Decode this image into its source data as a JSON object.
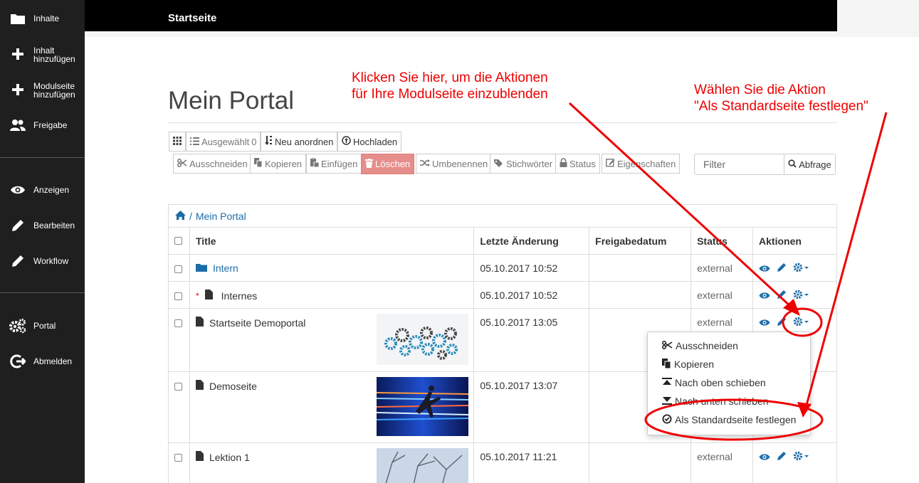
{
  "sidebar": {
    "items": [
      {
        "label": "Inhalte",
        "icon": "folder-icon"
      },
      {
        "label": "Inhalt",
        "label2": "hinzufügen",
        "icon": "plus-icon"
      },
      {
        "label": "Modulseite",
        "label2": "hinzufügen",
        "icon": "plus-icon"
      },
      {
        "label": "Freigabe",
        "icon": "users-icon"
      },
      {
        "label": "Anzeigen",
        "icon": "eye-icon"
      },
      {
        "label": "Bearbeiten",
        "icon": "pencil-icon"
      },
      {
        "label": "Workflow",
        "icon": "pencil-icon"
      },
      {
        "label": "Portal",
        "icon": "gears-icon"
      },
      {
        "label": "Abmelden",
        "icon": "logout-icon"
      }
    ]
  },
  "header": {
    "title": "Startseite"
  },
  "page": {
    "title": "Mein Portal"
  },
  "toolbar": {
    "selected_label": "Ausgewählt",
    "selected_count": "0",
    "reorder": "Neu anordnen",
    "upload": "Hochladen",
    "cut": "Ausschneiden",
    "copy": "Kopieren",
    "paste": "Einfügen",
    "delete": "Löschen",
    "rename": "Umbenennen",
    "tags": "Stichwörter",
    "status": "Status",
    "properties": "Eigenschaften"
  },
  "filter": {
    "placeholder": "Filter",
    "button": "Abfrage"
  },
  "breadcrumb": {
    "separator": "/",
    "current": "Mein Portal"
  },
  "table": {
    "headers": {
      "title": "Title",
      "modified": "Letzte Änderung",
      "published": "Freigabedatum",
      "status": "Status",
      "actions": "Aktionen"
    },
    "rows": [
      {
        "title": "Intern",
        "modified": "05.10.2017 10:52",
        "published": "",
        "status": "external",
        "type": "folder"
      },
      {
        "title": "Internes",
        "modified": "05.10.2017 10:52",
        "published": "",
        "status": "external",
        "type": "document",
        "required_mark": "*"
      },
      {
        "title": "Startseite Demoportal",
        "modified": "05.10.2017 13:05",
        "published": "",
        "status": "external",
        "type": "document"
      },
      {
        "title": "Demoseite",
        "modified": "05.10.2017 13:07",
        "published": "",
        "status": "",
        "type": "document"
      },
      {
        "title": "Lektion 1",
        "modified": "05.10.2017 11:21",
        "published": "",
        "status": "external",
        "type": "document"
      }
    ]
  },
  "dropdown": {
    "items": [
      "Ausschneiden",
      "Kopieren",
      "Nach oben schieben",
      "Nach unten schieben",
      "Als Standardseite festlegen"
    ]
  },
  "annotations": {
    "left_line1": "Klicken Sie hier, um die Aktionen",
    "left_line2": "für Ihre Modulseite einzublenden",
    "right_line1": "Wählen Sie die Aktion",
    "right_line2": "\"Als Standardseite festlegen\""
  },
  "colors": {
    "link": "#1c6ca8",
    "annotation": "#ee0000",
    "sidebar": "#1f1f1f",
    "danger": "#e58e8c"
  }
}
